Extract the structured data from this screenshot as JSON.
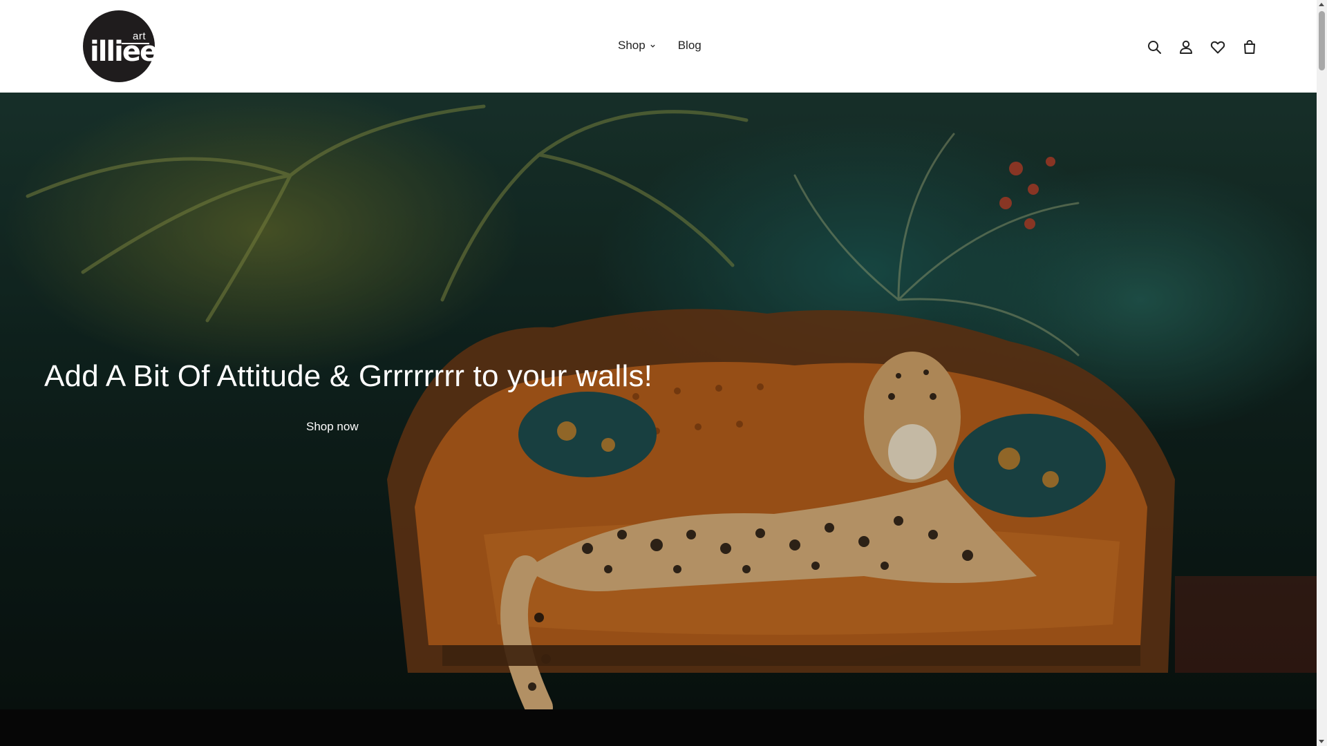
{
  "header": {
    "logo": {
      "word": "illiee",
      "tagline": "art"
    },
    "nav": [
      {
        "label": "Shop",
        "has_dropdown": true
      },
      {
        "label": "Blog",
        "has_dropdown": false
      }
    ],
    "icons": [
      "search-icon",
      "account-icon",
      "wishlist-icon",
      "cart-icon"
    ]
  },
  "hero": {
    "title": "Add A Bit Of Attitude & Grrrrrrrr to your walls!",
    "cta_label": "Shop now"
  },
  "colors": {
    "logo_bg": "#1f1c1d",
    "header_bg": "#ffffff",
    "text_dark": "#222222",
    "hero_text": "#ffffff",
    "band_bg": "#060606"
  }
}
